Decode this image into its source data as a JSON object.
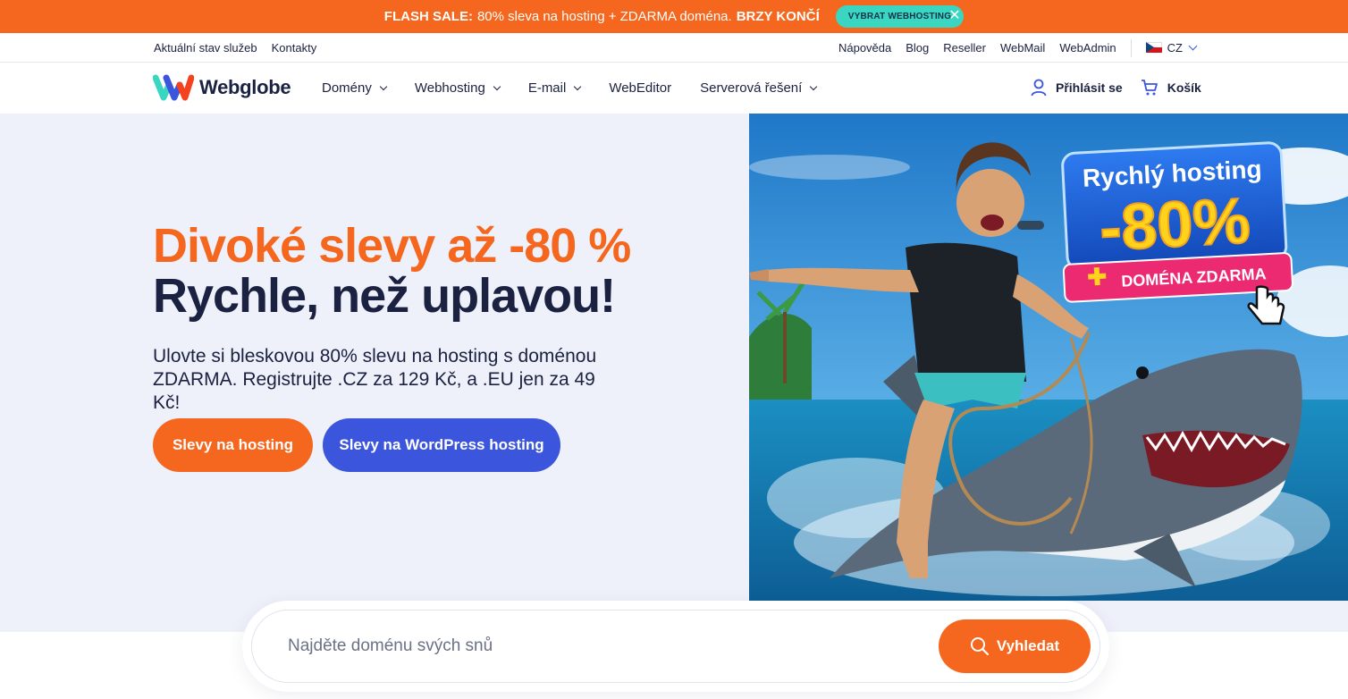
{
  "flash": {
    "label": "FLASH SALE:",
    "text": "80% sleva na hosting + ZDARMA doména.",
    "emphasis": "BRZY KONČÍ",
    "cta": "VYBRAT WEBHOSTING",
    "close_icon": "close-icon"
  },
  "utility": {
    "left": [
      "Aktuální stav služeb",
      "Kontakty"
    ],
    "right": [
      "Nápověda",
      "Blog",
      "Reseller",
      "WebMail",
      "WebAdmin"
    ],
    "language": "CZ"
  },
  "nav": {
    "logo": "Webglobe",
    "menu": [
      "Domény",
      "Webhosting",
      "E-mail",
      "WebEditor",
      "Serverová řešení"
    ],
    "login": "Přihlásit se",
    "cart": "Košík"
  },
  "hero": {
    "headline_1": "Divoké slevy až -80 %",
    "headline_2": "Rychle, než uplavou!",
    "lead": "Ulovte si bleskovou 80% slevu na hosting s doménou ZDARMA. Registrujte .CZ za 129 Kč, a .EU jen za 49 Kč!",
    "btn_hosting": "Slevy na hosting",
    "btn_wp": "Slevy na WordPress hosting",
    "badge_title": "Rychlý hosting",
    "badge_percent": "-80%",
    "badge_sub": "DOMÉNA ZDARMA"
  },
  "search": {
    "placeholder": "Najděte doménu svých snů",
    "button": "Vyhledat"
  },
  "colors": {
    "accent": "#f5671e",
    "blue": "#3b56dc",
    "teal": "#3ad6c2",
    "dark": "#1b2140",
    "hero_bg": "#eef1fa"
  }
}
